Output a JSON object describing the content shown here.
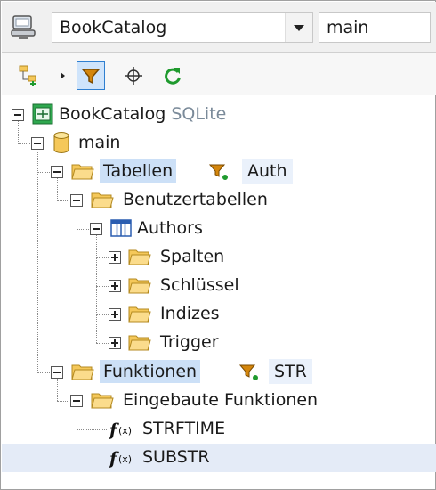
{
  "topbar": {
    "database_select": {
      "value": "BookCatalog",
      "icon": "database-connection-icon"
    },
    "schema_select": {
      "value": "main"
    }
  },
  "toolbar": {
    "buttons": [
      {
        "name": "add-object-icon",
        "active": false
      },
      {
        "name": "filter-icon",
        "active": true
      },
      {
        "name": "locate-icon",
        "active": false
      },
      {
        "name": "refresh-icon",
        "active": false
      }
    ]
  },
  "tree": {
    "root": {
      "label": "BookCatalog",
      "suffix": "SQLite"
    },
    "schema": {
      "label": "main"
    },
    "tables_folder": {
      "label": "Tabellen",
      "filter": "Auth"
    },
    "user_tables": {
      "label": "Benutzertabellen"
    },
    "authors": {
      "label": "Authors"
    },
    "author_children": [
      "Spalten",
      "Schlüssel",
      "Indizes",
      "Trigger"
    ],
    "functions_folder": {
      "label": "Funktionen",
      "filter": "STR"
    },
    "builtin_functions": {
      "label": "Eingebaute Funktionen"
    },
    "functions": [
      "STRFTIME",
      "SUBSTR"
    ]
  },
  "colors": {
    "selection": "#cce0f7",
    "selected_row": "#e4ebf7",
    "folder": "#f5c85a",
    "filter_funnel": "#d4860c",
    "refresh": "#1f9a2e"
  }
}
